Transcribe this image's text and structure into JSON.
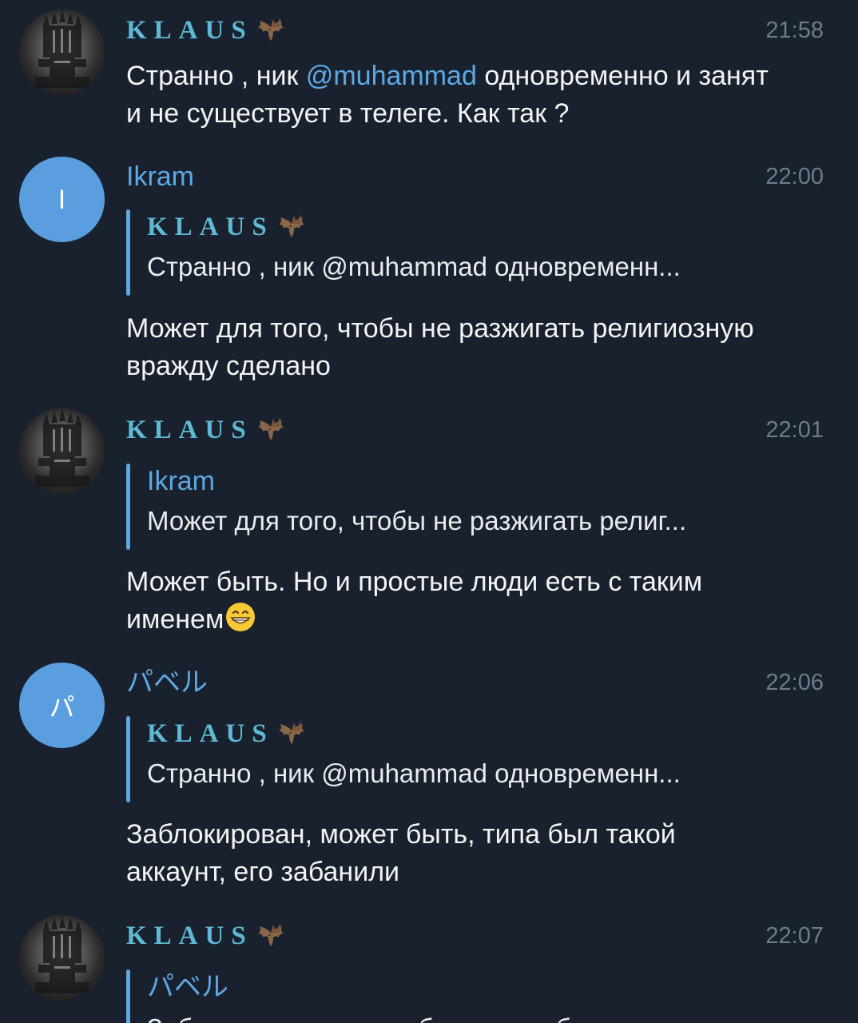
{
  "chat": {
    "messages": [
      {
        "sender": "KLAUS",
        "time": "21:58",
        "text_before": "Странно , ник ",
        "mention": "@muhammad",
        "text_after": " одновременно и занят и не существует в телеге. Как так ?"
      },
      {
        "sender": "Ikram",
        "avatar_letter": "I",
        "time": "22:00",
        "reply_sender": "KLAUS",
        "reply_text": "Странно , ник @muhammad одновременн...",
        "text": "Может для того, чтобы не разжигать религиозную вражду сделано"
      },
      {
        "sender": "KLAUS",
        "time": "22:01",
        "reply_sender": "Ikram",
        "reply_text": "Может для того, чтобы не разжигать религ...",
        "text": "Может быть. Но и простые люди есть с таким именем",
        "emoji": "grinning-face-emoji"
      },
      {
        "sender": "パベル",
        "avatar_letter": "パ",
        "time": "22:06",
        "reply_sender": "KLAUS",
        "reply_text": "Странно , ник @muhammad одновременн...",
        "text": "Заблокирован, может быть, типа был такой аккаунт, его забанили"
      },
      {
        "sender": "KLAUS",
        "time": "22:07",
        "reply_sender": "パベル",
        "reply_text": "Заблокирован, может быть, типа был таког..."
      }
    ]
  },
  "colors": {
    "background": "#18212d",
    "accent_blue": "#5ea8e4",
    "klaus_name": "#5fb9d4",
    "avatar_blue": "#5a9ee0",
    "time_gray": "#6e7c8a"
  },
  "icons": {
    "sender_badge": "bat-emoji",
    "klaus_avatar": "iron-throne-photo"
  }
}
